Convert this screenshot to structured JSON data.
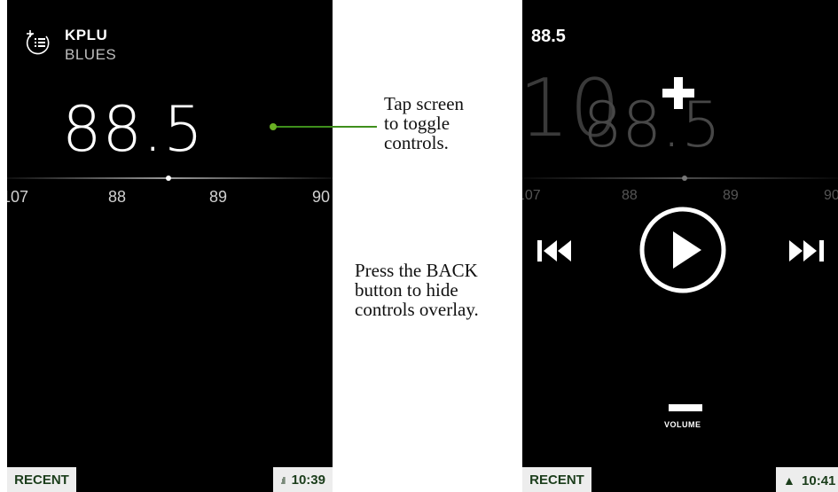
{
  "left": {
    "station": "KPLU",
    "genre": "BLUES",
    "frequency": "88.5",
    "ticks": [
      "107",
      "88",
      "89",
      "90"
    ],
    "recent_label": "RECENT",
    "time": "10:39",
    "signal_icon": "signal-bars-icon"
  },
  "annotations": {
    "tap": [
      "Tap screen",
      "to toggle",
      "controls."
    ],
    "back": [
      "Press the BACK",
      "button to hide",
      "controls overlay."
    ]
  },
  "right": {
    "frequency_small": "88.5",
    "ghost_big": "10",
    "ghost_frequency": "88.5",
    "ticks": [
      "107",
      "88",
      "89",
      "90"
    ],
    "volume_label": "VOLUME",
    "recent_label": "RECENT",
    "time": "10:41",
    "status_icon": "triangle-up-icon"
  },
  "colors": {
    "accent_green": "#6ab023",
    "bar_bg": "#ededed",
    "bar_text": "#1b3d1b"
  }
}
